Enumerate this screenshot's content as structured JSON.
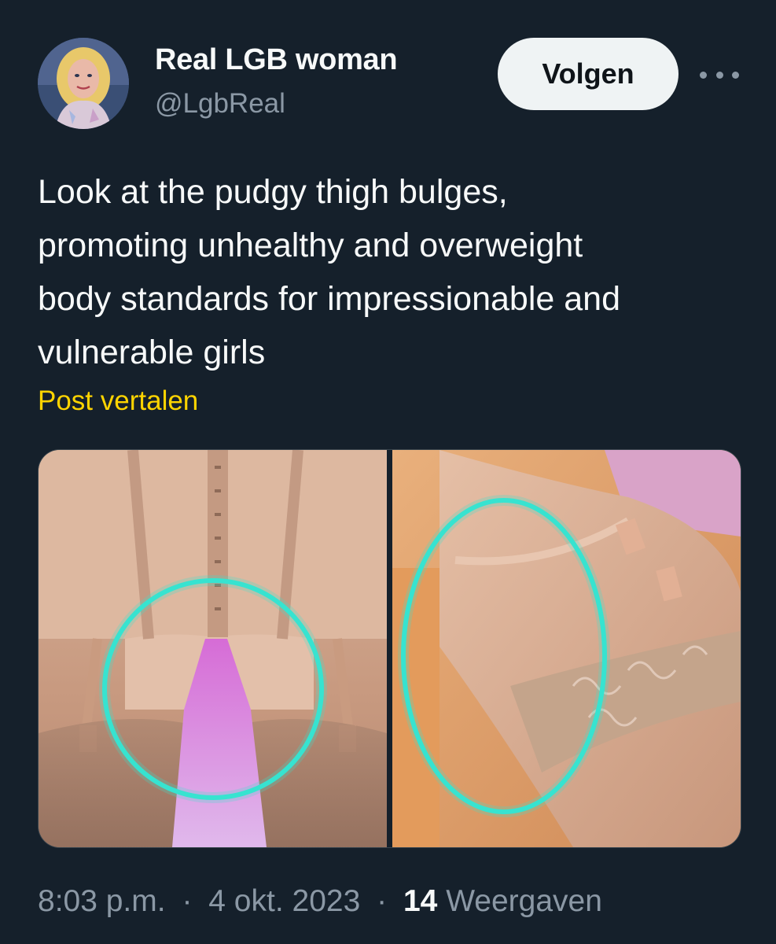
{
  "post": {
    "author": {
      "display_name": "Real LGB woman",
      "handle": "@LgbReal",
      "avatar_icon": "avatar-illustration"
    },
    "follow_label": "Volgen",
    "more_icon": "ellipsis-icon",
    "text": "Look at the pudgy thigh bulges,\npromoting unhealthy and overweight\nbody standards for impressionable and\nvulnerable girls",
    "translate_label": "Post vertalen",
    "media": {
      "count": 2,
      "images": [
        "photo-lingerie-back",
        "photo-lingerie-side"
      ],
      "highlight_color": "#37e3d0"
    },
    "meta": {
      "time": "8:03 p.m.",
      "separator": "·",
      "date": "4 okt. 2023",
      "views_count": "14",
      "views_label": "Weergaven"
    }
  },
  "theme": {
    "background": "#15202b",
    "text_primary": "#f7f9f9",
    "text_secondary": "#8b98a5",
    "accent_link": "#ffd400",
    "button_bg": "#eff3f4"
  }
}
